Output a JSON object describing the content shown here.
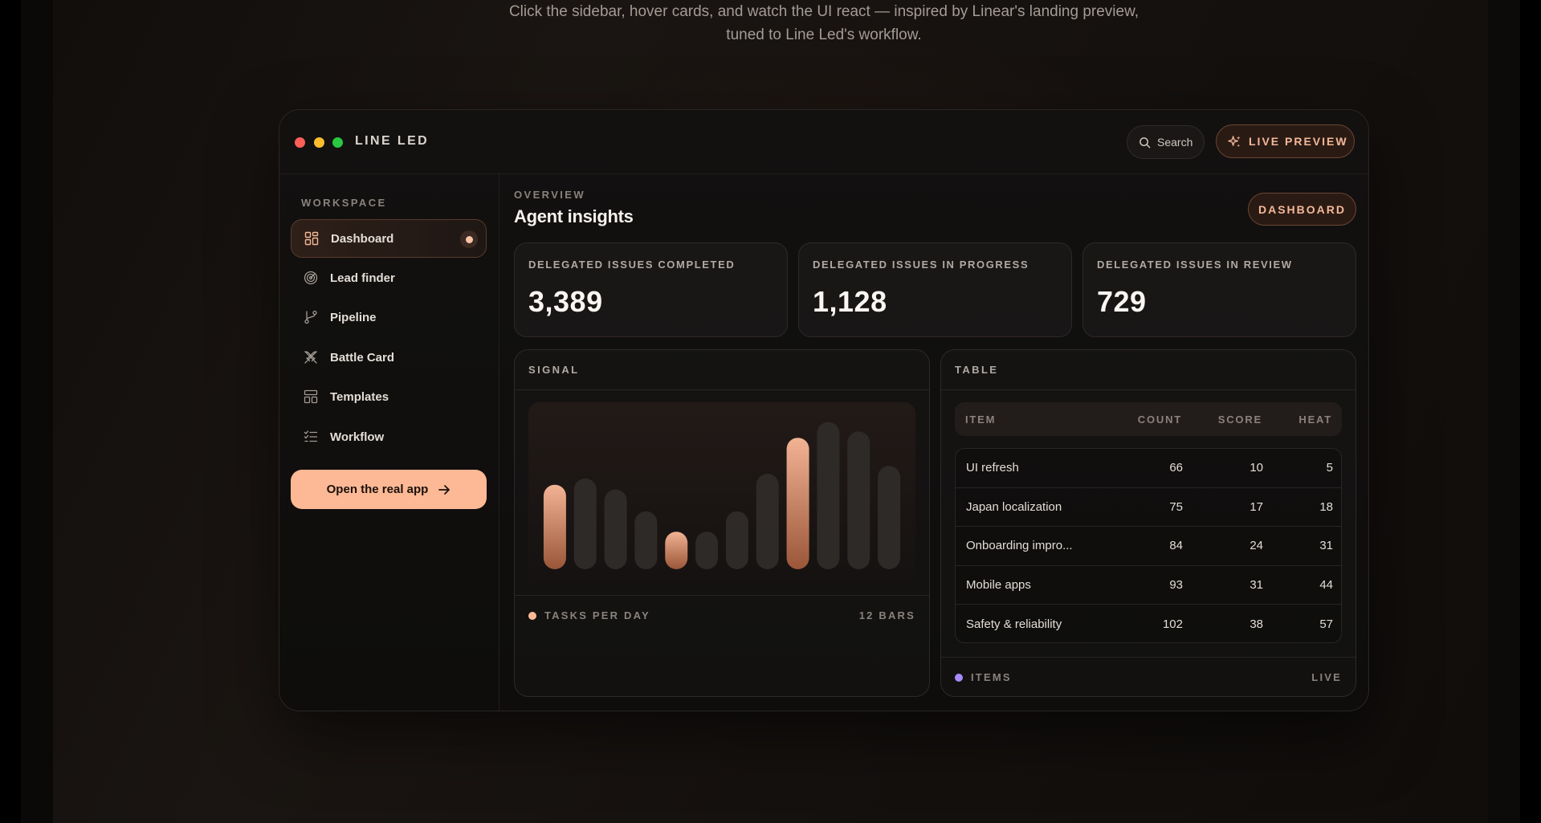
{
  "page": {
    "subtitle_line1": "Click the sidebar, hover cards, and watch the UI react — inspired by Linear's landing preview,",
    "subtitle_line2": "tuned to Line Led's workflow."
  },
  "titlebar": {
    "brand": "LINE LED",
    "search_label": "Search",
    "live_label": "LIVE PREVIEW"
  },
  "sidebar": {
    "section": "WORKSPACE",
    "items": [
      {
        "label": "Dashboard",
        "icon": "grid-icon",
        "active": true
      },
      {
        "label": "Lead finder",
        "icon": "radar-icon",
        "active": false
      },
      {
        "label": "Pipeline",
        "icon": "branch-icon",
        "active": false
      },
      {
        "label": "Battle Card",
        "icon": "swords-icon",
        "active": false
      },
      {
        "label": "Templates",
        "icon": "layout-icon",
        "active": false
      },
      {
        "label": "Workflow",
        "icon": "checklist-icon",
        "active": false
      }
    ],
    "cta": "Open the real app"
  },
  "main": {
    "overview": "OVERVIEW",
    "title": "Agent insights",
    "badge": "DASHBOARD",
    "stats": [
      {
        "label": "DELEGATED ISSUES COMPLETED",
        "value": "3,389"
      },
      {
        "label": "DELEGATED ISSUES IN PROGRESS",
        "value": "1,128"
      },
      {
        "label": "DELEGATED ISSUES IN REVIEW",
        "value": "729"
      }
    ]
  },
  "signal": {
    "title": "SIGNAL",
    "legend": "TASKS PER DAY",
    "count_label": "12 BARS"
  },
  "chart_data": {
    "type": "bar",
    "series": [
      {
        "values": [
          0.54,
          0.58,
          0.51,
          0.37,
          0.24,
          0.24,
          0.37,
          0.61,
          0.84,
          0.94,
          0.88,
          0.66
        ]
      }
    ],
    "highlighted": [
      0,
      4,
      8
    ],
    "colors": {
      "highlight": "#e9a07a",
      "base": "#2e2a28"
    }
  },
  "table": {
    "title": "TABLE",
    "columns": [
      "ITEM",
      "COUNT",
      "SCORE",
      "HEAT"
    ],
    "rows": [
      [
        "UI refresh",
        "66",
        "10",
        "5"
      ],
      [
        "Japan localization",
        "75",
        "17",
        "18"
      ],
      [
        "Onboarding impro...",
        "84",
        "24",
        "31"
      ],
      [
        "Mobile apps",
        "93",
        "31",
        "44"
      ],
      [
        "Safety & reliability",
        "102",
        "38",
        "57"
      ]
    ],
    "legend": "ITEMS",
    "status": "LIVE"
  },
  "colors": {
    "accent": "#fdb995",
    "signal_dot": "#fdb995",
    "items_dot": "#a78bfa"
  }
}
